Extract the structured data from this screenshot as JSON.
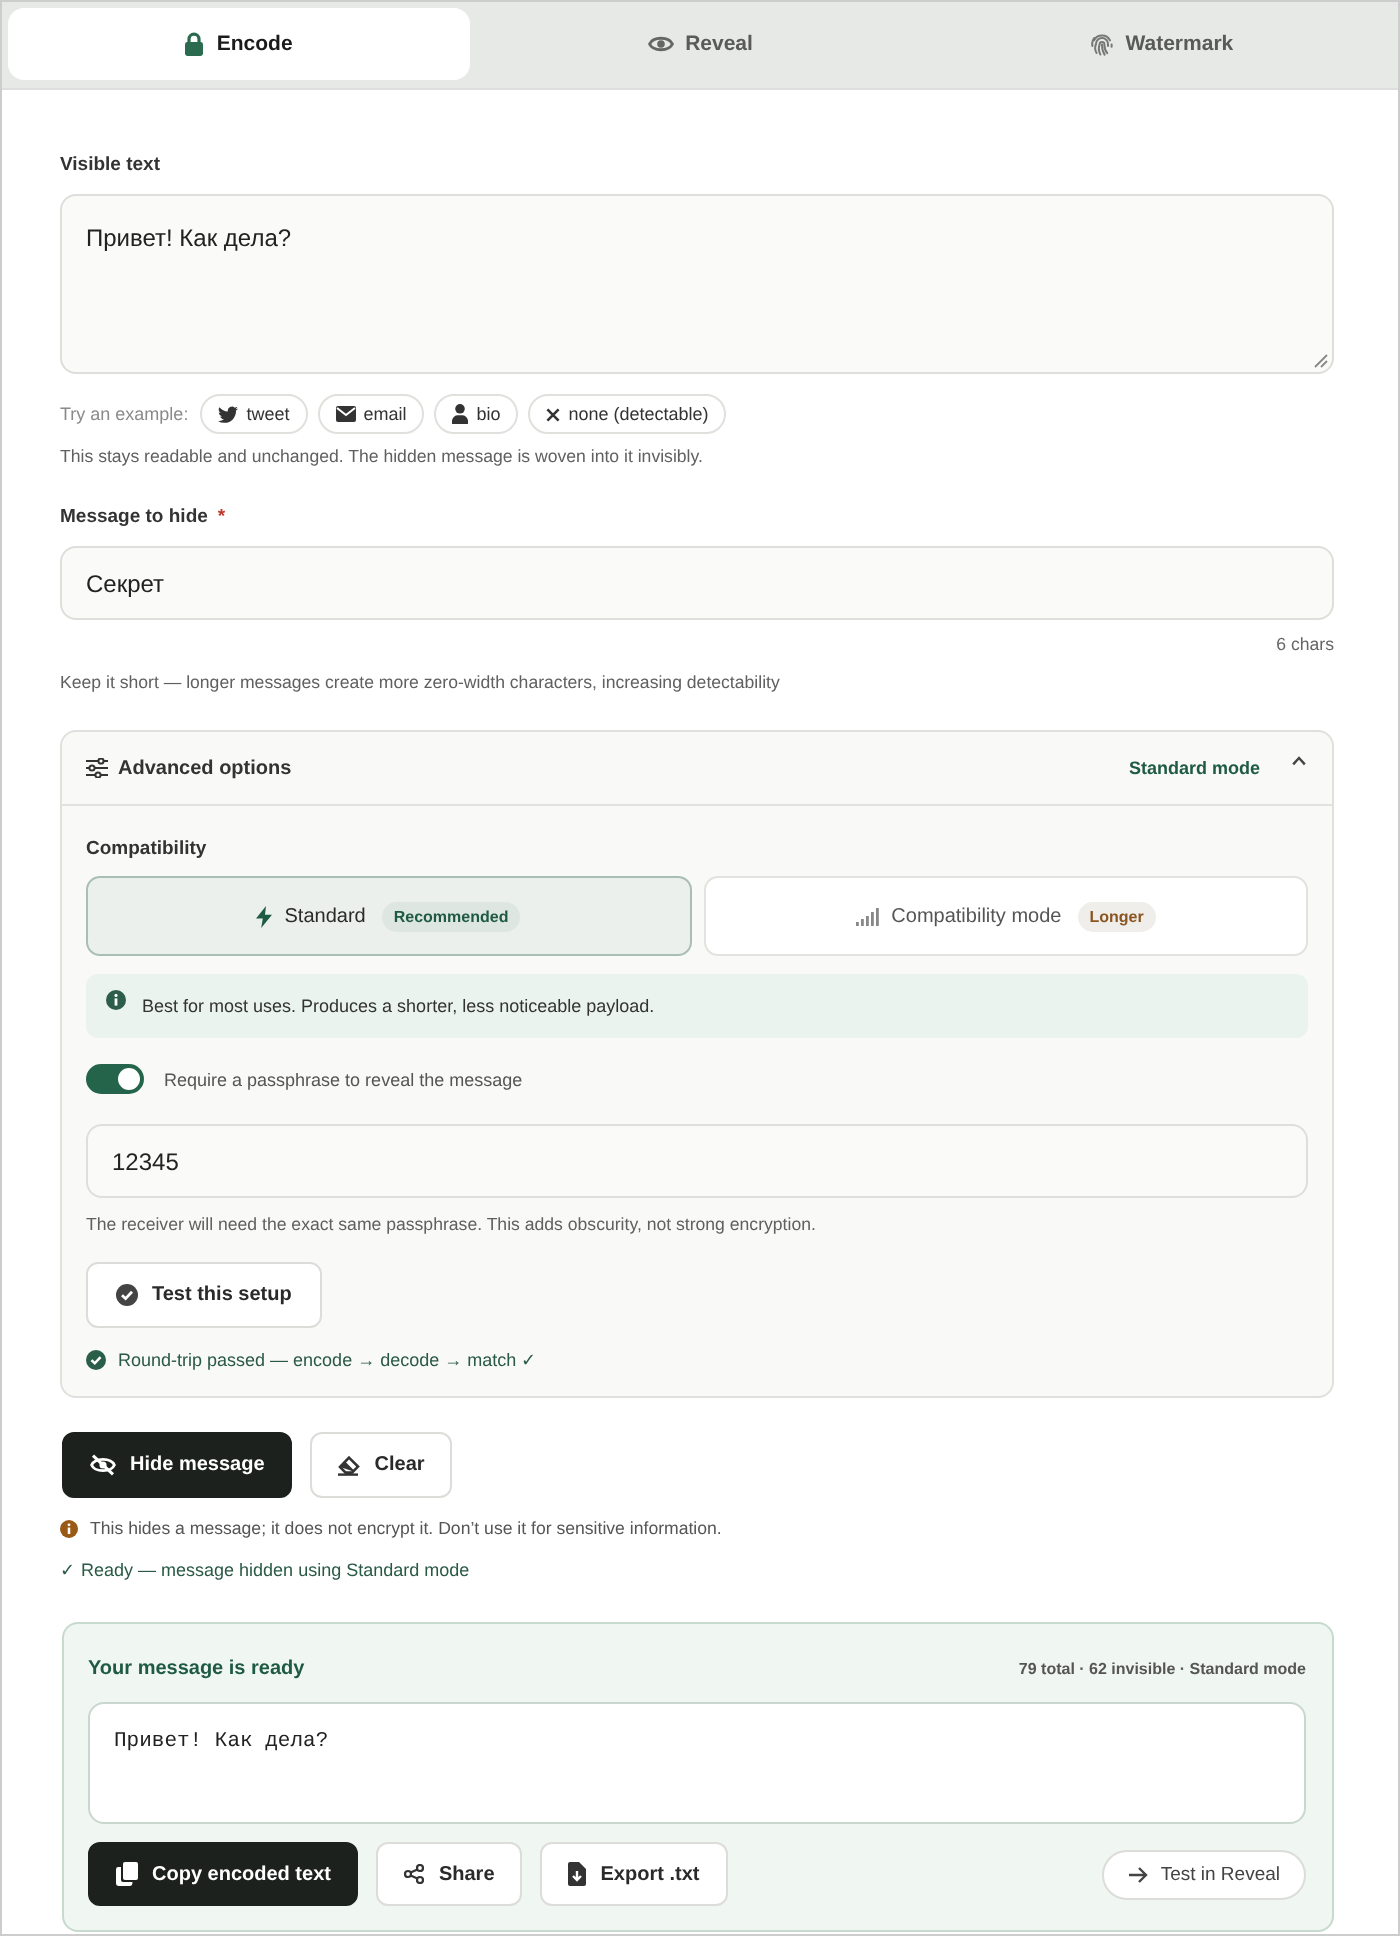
{
  "tabs": [
    {
      "label": "Encode",
      "selected": true
    },
    {
      "label": "Reveal",
      "selected": false
    },
    {
      "label": "Watermark",
      "selected": false
    }
  ],
  "visible_text": {
    "label": "Visible text",
    "value": "Привет! Как дела?"
  },
  "examples": {
    "label": "Try an example:",
    "chips": [
      {
        "label": "tweet"
      },
      {
        "label": "email"
      },
      {
        "label": "bio"
      },
      {
        "label": "none (detectable)"
      }
    ]
  },
  "visible_help": "This stays readable and unchanged. The hidden message is woven into it invisibly.",
  "message": {
    "label": "Message to hide",
    "required_mark": "*",
    "value": "Секрет",
    "counter": "6 chars",
    "help": "Keep it short — longer messages create more zero-width characters, increasing detectability"
  },
  "advanced": {
    "title": "Advanced options",
    "summary": "Standard mode",
    "expanded": true,
    "compatibility": {
      "label": "Compatibility",
      "options": [
        {
          "label": "Standard",
          "badge": "Recommended",
          "color": "#1f5a43",
          "selected": true
        },
        {
          "label": "Compatibility mode",
          "badge": "Longer",
          "color": "#8a5520",
          "selected": false
        }
      ],
      "info": "Best for most uses. Produces a shorter, less noticeable payload."
    },
    "passphrase": {
      "label": "Require a passphrase to reveal the message",
      "on": true,
      "value": "12345",
      "help": "The receiver will need the exact same passphrase. This adds obscurity, not strong encryption."
    },
    "test_button": "Test this setup",
    "test_result": "Round-trip passed — encode → decode → match ✓"
  },
  "actions": [
    {
      "label": "Hide message",
      "kind": "primary"
    },
    {
      "label": "Clear",
      "kind": "secondary"
    }
  ],
  "warning": "This hides a message; it does not encrypt it. Don’t use it for sensitive information.",
  "status": "✓ Ready — message hidden using Standard mode",
  "result": {
    "title": "Your message is ready",
    "stats": "79 total · 62 invisible · Standard mode",
    "output": "Привет! Как дела?",
    "buttons": [
      {
        "label": "Copy encoded text",
        "kind": "primary"
      },
      {
        "label": "Share",
        "kind": "secondary"
      },
      {
        "label": "Export .txt",
        "kind": "secondary"
      }
    ],
    "test_link": "Test in Reveal"
  }
}
